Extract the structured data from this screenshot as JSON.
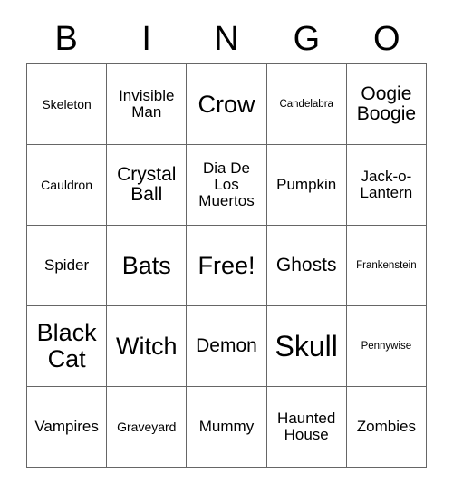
{
  "card": {
    "title": "BINGO",
    "header_letters": [
      "B",
      "I",
      "N",
      "G",
      "O"
    ],
    "grid": [
      [
        {
          "label": "Skeleton",
          "size": "s"
        },
        {
          "label": "Invisible Man",
          "size": "m"
        },
        {
          "label": "Crow",
          "size": "xl"
        },
        {
          "label": "Candelabra",
          "size": "xs"
        },
        {
          "label": "Oogie Boogie",
          "size": "l"
        }
      ],
      [
        {
          "label": "Cauldron",
          "size": "s"
        },
        {
          "label": "Crystal Ball",
          "size": "l"
        },
        {
          "label": "Dia De Los Muertos",
          "size": "m"
        },
        {
          "label": "Pumpkin",
          "size": "m"
        },
        {
          "label": "Jack-o-Lantern",
          "size": "m"
        }
      ],
      [
        {
          "label": "Spider",
          "size": "m"
        },
        {
          "label": "Bats",
          "size": "xl"
        },
        {
          "label": "Free!",
          "size": "xl"
        },
        {
          "label": "Ghosts",
          "size": "l"
        },
        {
          "label": "Frankenstein",
          "size": "xs"
        }
      ],
      [
        {
          "label": "Black Cat",
          "size": "xl"
        },
        {
          "label": "Witch",
          "size": "xl"
        },
        {
          "label": "Demon",
          "size": "l"
        },
        {
          "label": "Skull",
          "size": "xxl"
        },
        {
          "label": "Pennywise",
          "size": "xs"
        }
      ],
      [
        {
          "label": "Vampires",
          "size": "m"
        },
        {
          "label": "Graveyard",
          "size": "s"
        },
        {
          "label": "Mummy",
          "size": "m"
        },
        {
          "label": "Haunted House",
          "size": "m"
        },
        {
          "label": "Zombies",
          "size": "m"
        }
      ]
    ],
    "free_space": "Free!",
    "colors": {
      "background": "#ffffff",
      "text": "#000000",
      "border": "#666666"
    }
  }
}
